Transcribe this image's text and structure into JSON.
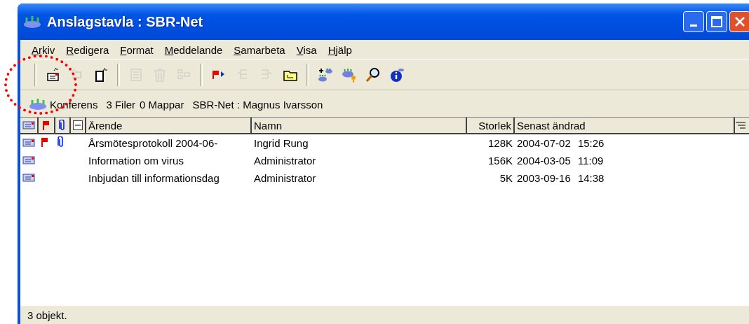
{
  "window": {
    "title": "Anslagstavla : SBR-Net"
  },
  "menu": [
    {
      "label": "Arkiv"
    },
    {
      "label": "Redigera"
    },
    {
      "label": "Format"
    },
    {
      "label": "Meddelande"
    },
    {
      "label": "Samarbeta"
    },
    {
      "label": "Visa"
    },
    {
      "label": "Hjälp"
    }
  ],
  "toolbar": [
    {
      "kind": "new-message",
      "disabled": false
    },
    {
      "kind": "reply",
      "disabled": true
    },
    {
      "kind": "new-document",
      "disabled": false
    },
    {
      "kind": "sep"
    },
    {
      "kind": "form",
      "disabled": true
    },
    {
      "kind": "trash",
      "disabled": true
    },
    {
      "kind": "move",
      "disabled": true
    },
    {
      "kind": "sep"
    },
    {
      "kind": "flag",
      "disabled": false
    },
    {
      "kind": "prev",
      "disabled": true
    },
    {
      "kind": "next",
      "disabled": true
    },
    {
      "kind": "folder",
      "disabled": false
    },
    {
      "kind": "sep"
    },
    {
      "kind": "add-conference",
      "disabled": false
    },
    {
      "kind": "conference-key",
      "disabled": false
    },
    {
      "kind": "search",
      "disabled": false
    },
    {
      "kind": "info",
      "disabled": false
    }
  ],
  "info_bar": {
    "type": "Konferens",
    "files": "3 Filer",
    "folders": "0 Mappar",
    "owner": "SBR-Net : Magnus Ivarsson"
  },
  "table": {
    "columns": [
      "Ärende",
      "Namn",
      "Storlek",
      "Senast ändrad"
    ],
    "rows": [
      {
        "flag": true,
        "attachment": true,
        "subject": "Årsmötesprotokoll 2004-06-",
        "name": "Ingrid Rung",
        "size": "128K",
        "date": "2004-07-02",
        "time": "15:26"
      },
      {
        "flag": false,
        "attachment": false,
        "subject": "Information om virus",
        "name": "Administrator",
        "size": "156K",
        "date": "2004-03-05",
        "time": "11:09"
      },
      {
        "flag": false,
        "attachment": false,
        "subject": "Inbjudan till informationsdag",
        "name": "Administrator",
        "size": "5K",
        "date": "2003-09-16",
        "time": "14:38"
      }
    ]
  },
  "status_bar": "3 objekt."
}
